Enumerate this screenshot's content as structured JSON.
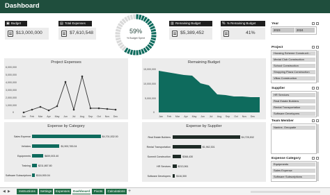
{
  "header": {
    "title": "Dashboard"
  },
  "kpis": [
    {
      "label": "Budget",
      "value": "$13,000,000",
      "icon": "budget-icon"
    },
    {
      "label": "Total Expenses",
      "value": "$7,610,548",
      "icon": "expense-icon"
    },
    {
      "label": "Remaining Budget",
      "value": "$5,389,452",
      "icon": "wallet-icon"
    },
    {
      "label": "% Remaining Budget",
      "value": "41%",
      "icon": "percent-icon"
    }
  ],
  "gauge": {
    "percent_text": "59%",
    "subtitle": "% Budget Spent",
    "fraction": 0.59,
    "color": "#0e6b5d",
    "track_color": "#d9d9d9"
  },
  "project_expenses": {
    "title": "Project Expenses",
    "yticks": [
      "6,000,000",
      "5,000,000",
      "4,000,000",
      "3,000,000",
      "2,000,000",
      "1,000,000",
      "0"
    ],
    "months": [
      "Jan",
      "Feb",
      "Mar",
      "Apr",
      "May",
      "Jun",
      "Jul",
      "Aug",
      "Sep",
      "Oct",
      "Nov",
      "Dec"
    ]
  },
  "remaining_budget": {
    "title": "Remaining Budget",
    "yticks": [
      "15,000,000",
      "10,000,000",
      "5,000,000",
      "0"
    ],
    "months": [
      "Jan",
      "Feb",
      "Mar",
      "Apr",
      "May",
      "Jun",
      "Jul",
      "Aug",
      "Sep",
      "Oct",
      "Nov",
      "Dec"
    ]
  },
  "expense_by_category": {
    "title": "Expense by Category",
    "rows": [
      {
        "label": "Sales Expense",
        "value": "$4,701,532.00",
        "fraction": 0.85
      },
      {
        "label": "Vehicles",
        "value": "$1,900,783.04",
        "fraction": 0.34
      },
      {
        "label": "Equipments",
        "value": "$659,003.40",
        "fraction": 0.14
      },
      {
        "label": "Training",
        "value": "$211,867.80",
        "fraction": 0.06
      },
      {
        "label": "Software Subscriptions",
        "value": "$116,900.04",
        "fraction": 0.035
      }
    ]
  },
  "expense_by_supplier": {
    "title": "Expense by Supplier",
    "rows": [
      {
        "label": "Real Estate Builders",
        "value": "$4,725,532",
        "fraction": 0.88
      },
      {
        "label": "Rental Transportation",
        "value": "$1,962,301",
        "fraction": 0.37
      },
      {
        "label": "Summit Construction",
        "value": "$368,430",
        "fraction": 0.11
      },
      {
        "label": "HR Services",
        "value": "$213,961",
        "fraction": 0.05
      },
      {
        "label": "Software Developers",
        "value": "$116,300",
        "fraction": 0.03
      }
    ]
  },
  "filters": {
    "year": {
      "title": "Year",
      "options": [
        "2023",
        "2024"
      ]
    },
    "project": {
      "title": "Project",
      "items": [
        "Housing Scheme Constructi...",
        "Medal Club Construction",
        "School Construction",
        "Shopping Plaza Construction",
        "Villas Construction"
      ]
    },
    "supplier": {
      "title": "Supplier",
      "items": [
        "HR Services",
        "Real Estate Builders",
        "Rental Transportation",
        "Software Developers"
      ]
    },
    "team_member": {
      "title": "Team Member",
      "items": [
        "Nanine, Omopatie"
      ]
    },
    "expense_category": {
      "title": "Expense Category",
      "items": [
        "Equipments",
        "Sales Expense",
        "Software Subscriptions"
      ]
    }
  },
  "sheet_tabs": [
    "Instructions",
    "Settings",
    "Expenses",
    "Dashboard",
    "Pivots",
    "Calculations"
  ],
  "active_tab": "Dashboard",
  "colors": {
    "header": "#1f4e3d",
    "accent": "#0e6b5d",
    "dark_bar": "#1e2b26",
    "tab_green": "#1f6b44"
  }
}
